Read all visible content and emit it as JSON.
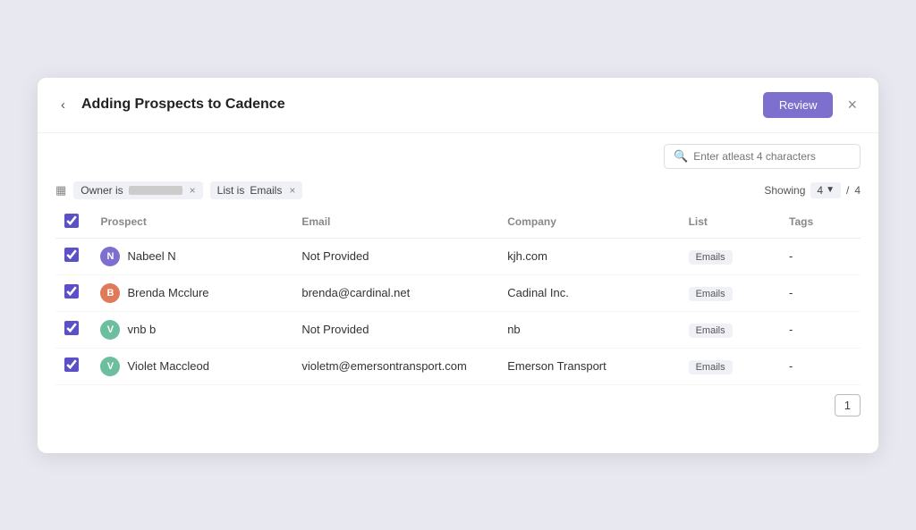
{
  "modal": {
    "title": "Adding Prospects to Cadence",
    "review_label": "Review",
    "close_label": "×",
    "back_label": "‹"
  },
  "search": {
    "placeholder": "Enter atleast 4 characters"
  },
  "filters": [
    {
      "id": "owner",
      "label": "Owner is",
      "value": "blurred",
      "removable": true
    },
    {
      "id": "list",
      "label": "List is",
      "value": "Emails",
      "removable": true
    }
  ],
  "showing": {
    "label": "Showing",
    "count": "4",
    "total": "4"
  },
  "table": {
    "headers": [
      "",
      "Prospect",
      "Email",
      "Company",
      "List",
      "Tags"
    ],
    "rows": [
      {
        "id": 1,
        "checked": true,
        "avatar_letter": "N",
        "avatar_color": "#7c6fcd",
        "name": "Nabeel N",
        "email": "Not Provided",
        "company": "kjh.com",
        "list": "Emails",
        "tags": "-"
      },
      {
        "id": 2,
        "checked": true,
        "avatar_letter": "B",
        "avatar_color": "#e07b5a",
        "name": "Brenda Mcclure",
        "email": "brenda@cardinal.net",
        "company": "Cadinal Inc.",
        "list": "Emails",
        "tags": "-"
      },
      {
        "id": 3,
        "checked": true,
        "avatar_letter": "V",
        "avatar_color": "#6bbf9e",
        "name": "vnb b",
        "email": "Not Provided",
        "company": "nb",
        "list": "Emails",
        "tags": "-"
      },
      {
        "id": 4,
        "checked": true,
        "avatar_letter": "V",
        "avatar_color": "#6bbf9e",
        "name": "Violet Maccleod",
        "email": "violetm@emersontransport.com",
        "company": "Emerson Transport",
        "list": "Emails",
        "tags": "-"
      }
    ]
  },
  "pagination": {
    "current": "1"
  }
}
